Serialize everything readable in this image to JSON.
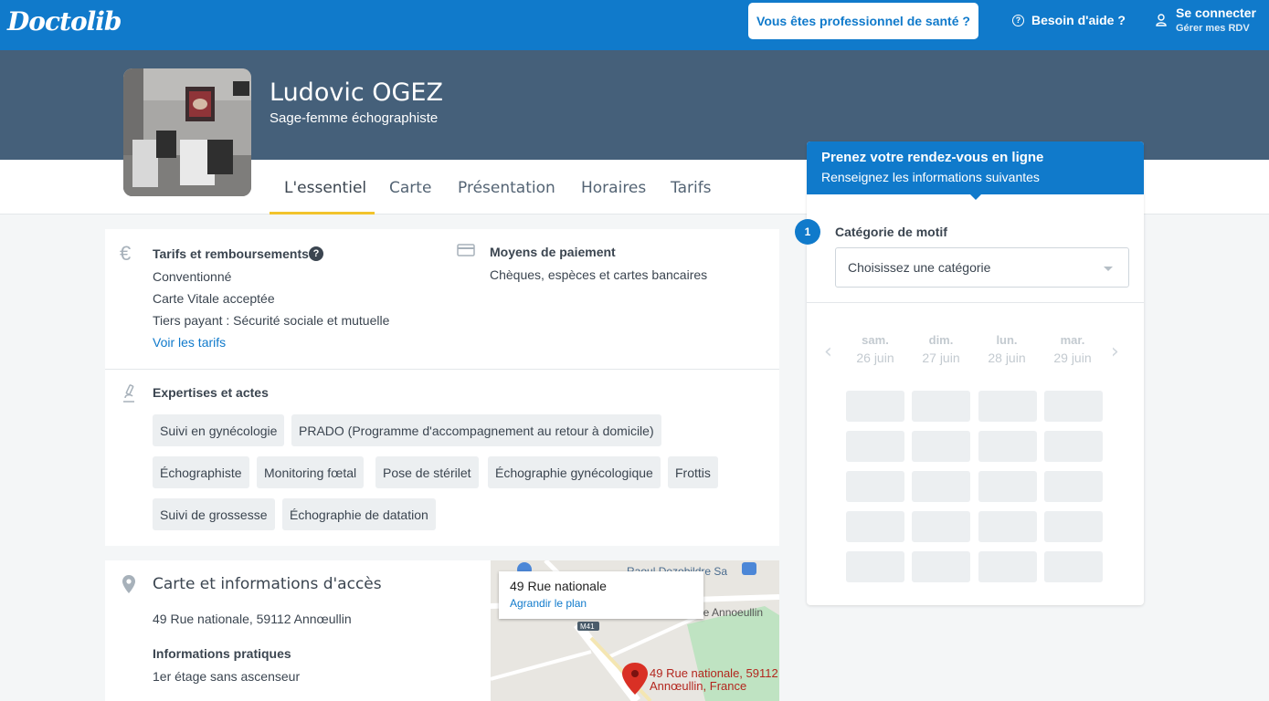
{
  "topbar": {
    "logo": "Doctolib",
    "pro_button": "Vous êtes professionnel de santé ?",
    "help": "Besoin d'aide ?",
    "login_title": "Se connecter",
    "login_sub": "Gérer mes RDV",
    "color": "#107acb"
  },
  "profile": {
    "name": "Ludovic OGEZ",
    "specialty": "Sage-femme échographiste"
  },
  "tabs": [
    "L'essentiel",
    "Carte",
    "Présentation",
    "Horaires",
    "Tarifs"
  ],
  "active_tab": "L'essentiel",
  "tarifs": {
    "title": "Tarifs et remboursements",
    "lines": [
      "Conventionné",
      "Carte Vitale acceptée",
      "Tiers payant : Sécurité sociale et mutuelle"
    ],
    "link": "Voir les tarifs"
  },
  "paiement": {
    "title": "Moyens de paiement",
    "text": "Chèques, espèces et cartes bancaires"
  },
  "expertises": {
    "title": "Expertises et actes",
    "tags": [
      "Suivi en gynécologie",
      "PRADO (Programme d'accompagnement au retour à domicile)",
      "Échographiste",
      "Monitoring fœtal",
      "Pose de stérilet",
      "Échographie gynécologique",
      "Frottis",
      "Suivi de grossesse",
      "Échographie de datation"
    ]
  },
  "carte": {
    "title": "Carte et informations d'accès",
    "address": "49 Rue nationale, 59112 Annœullin",
    "practical_title": "Informations pratiques",
    "practical_text": "1er étage sans ascenseur"
  },
  "map": {
    "popup_title": "49 Rue nationale",
    "popup_link": "Agrandir le plan",
    "label_poi": "Raoul Dezobildre Sa",
    "label_road": "M41",
    "label_street": "le Annoeullin",
    "marker_label_1": "49 Rue nationale, 59112",
    "marker_label_2": "Annœullin, France",
    "marker_color": "#d93025"
  },
  "booking": {
    "header_title": "Prenez votre rendez-vous en ligne",
    "header_sub": "Renseignez les informations suivantes",
    "step_number": "1",
    "step_label": "Catégorie de motif",
    "select_value": "Choisissez une catégorie",
    "days": [
      {
        "day": "sam.",
        "date": "26 juin"
      },
      {
        "day": "dim.",
        "date": "27 juin"
      },
      {
        "day": "lun.",
        "date": "28 juin"
      },
      {
        "day": "mar.",
        "date": "29 juin"
      }
    ]
  }
}
